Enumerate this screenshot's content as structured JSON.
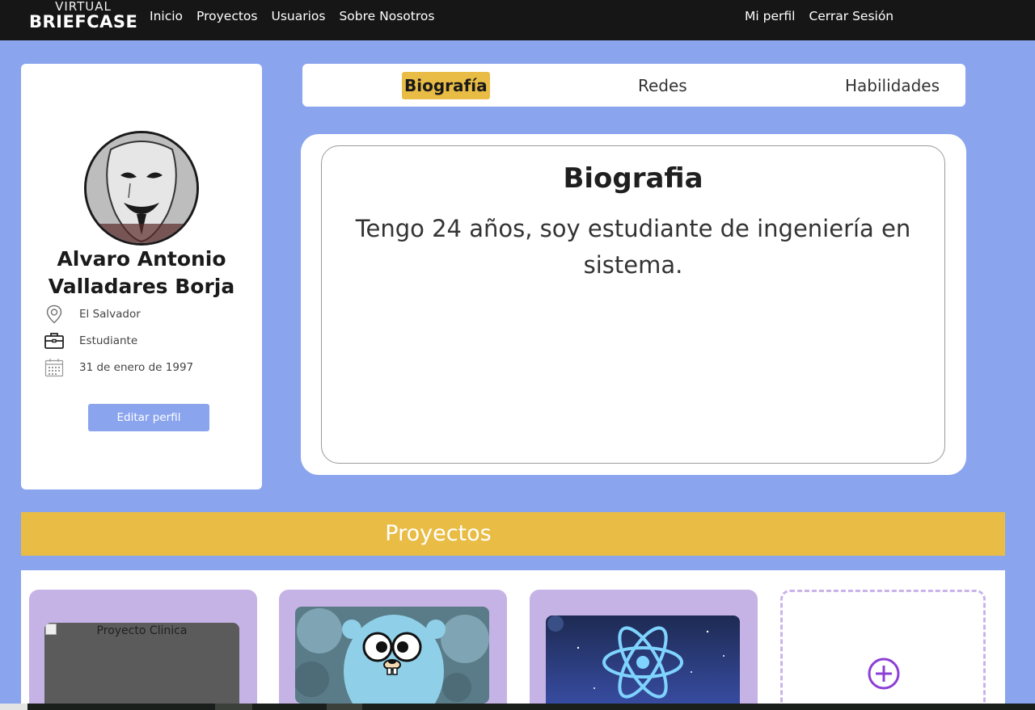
{
  "navbar": {
    "brand_top": "VIRTUAL",
    "brand_bottom": "BRIEFCASE",
    "links_left": [
      "Inicio",
      "Proyectos",
      "Usuarios",
      "Sobre Nosotros"
    ],
    "links_right": [
      "Mi perfil",
      "Cerrar Sesión"
    ]
  },
  "profile": {
    "name": "Alvaro Antonio Valladares Borja",
    "location": "El Salvador",
    "occupation": "Estudiante",
    "birthdate": "31 de enero de 1997",
    "edit_button": "Editar perfil",
    "icons": [
      "location-pin-icon",
      "briefcase-icon",
      "calendar-icon"
    ]
  },
  "tabs": {
    "items": [
      "Biografía",
      "Redes",
      "Habilidades"
    ],
    "active": "Biografía"
  },
  "bio": {
    "title": "Biografia",
    "text": "Tengo 24 años, soy estudiante de ingeniería en sistema."
  },
  "projects": {
    "title": "Proyectos",
    "items": [
      {
        "alt": "Proyecto Clinica",
        "image": "broken-image"
      },
      {
        "alt": "",
        "image": "go-gopher-image"
      },
      {
        "alt": "",
        "image": "react-logo-image"
      }
    ],
    "add_icon": "plus-circle-icon"
  },
  "colors": {
    "page_bg": "#8aa4ee",
    "navbar_bg": "#161616",
    "accent_yellow": "#e8bc45",
    "card_purple": "#c6b3e6",
    "add_purple": "#8c3fd6"
  }
}
